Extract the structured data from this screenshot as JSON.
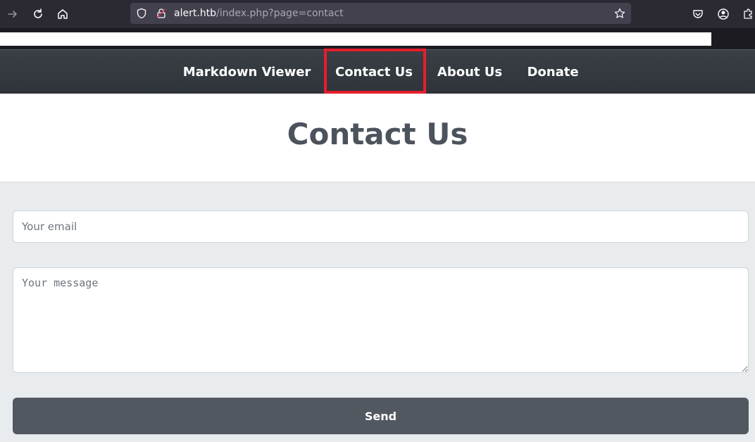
{
  "browser": {
    "url_host": "alert.htb",
    "url_path": "/index.php?page=contact",
    "icons": [
      "forward-icon",
      "reload-icon",
      "home-icon",
      "shield-icon",
      "lock-icon",
      "bookmark-star-icon",
      "pocket-icon",
      "account-icon",
      "extensions-icon"
    ]
  },
  "nav": {
    "items": [
      {
        "label": "Markdown Viewer"
      },
      {
        "label": "Contact Us",
        "highlighted": true
      },
      {
        "label": "About Us"
      },
      {
        "label": "Donate"
      }
    ],
    "highlight_color": "#e41f2b"
  },
  "page": {
    "title": "Contact Us"
  },
  "form": {
    "email_placeholder": "Your email",
    "email_value": "",
    "message_placeholder": "Your message",
    "message_value": "",
    "send_label": "Send"
  },
  "colors": {
    "navbar": "#343a40",
    "title": "#4c535c",
    "form_bg": "#e9ecef",
    "button": "#525860"
  }
}
